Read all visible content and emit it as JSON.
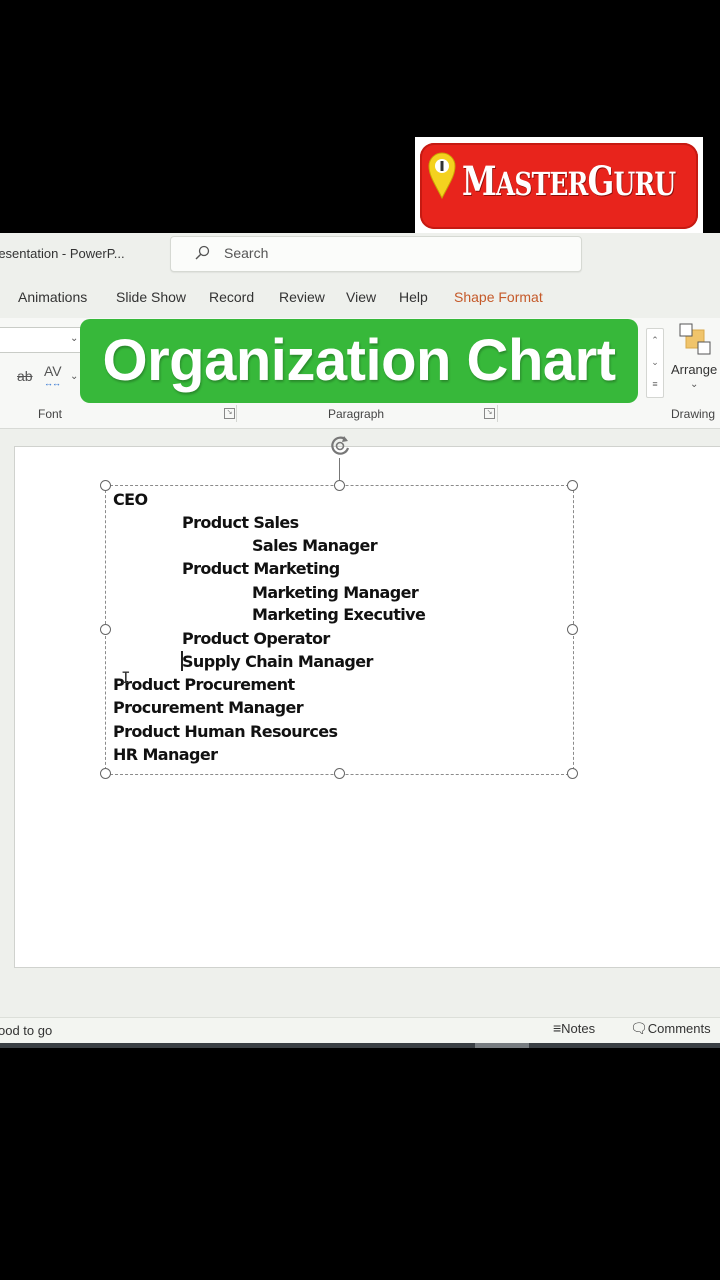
{
  "logo": {
    "brand_first": "M",
    "brand_rest_1": "ASTER",
    "brand_mid": "G",
    "brand_rest_2": "URU",
    "accent": "#e8241c"
  },
  "overlay": {
    "title": "Organization Chart",
    "color": "#37b83a"
  },
  "window": {
    "title": "resentation - PowerP..."
  },
  "search": {
    "placeholder": "Search"
  },
  "tabs": [
    {
      "label": "Animations"
    },
    {
      "label": "Slide Show"
    },
    {
      "label": "Record"
    },
    {
      "label": "Review"
    },
    {
      "label": "View"
    },
    {
      "label": "Help"
    },
    {
      "label": "Shape Format",
      "active": true
    }
  ],
  "ribbon": {
    "strike_label": "ab",
    "spacing_label": "AV",
    "groups": {
      "font": "Font",
      "paragraph": "Paragraph",
      "drawing": "Drawing"
    },
    "arrange_label": "Arrange"
  },
  "slide": {
    "lines": [
      {
        "text": "CEO",
        "level": 0
      },
      {
        "text": "Product Sales",
        "level": 1
      },
      {
        "text": "Sales Manager",
        "level": 2
      },
      {
        "text": "Product Marketing",
        "level": 1
      },
      {
        "text": "Marketing Manager",
        "level": 2
      },
      {
        "text": "Marketing Executive",
        "level": 2
      },
      {
        "text": "Product Operator",
        "level": 1
      },
      {
        "text": "Supply Chain Manager",
        "level": 1
      },
      {
        "text": "Product Procurement",
        "level": 0
      },
      {
        "text": "Procurement Manager",
        "level": 0
      },
      {
        "text": "Product Human Resources",
        "level": 0
      },
      {
        "text": "HR Manager",
        "level": 0
      }
    ]
  },
  "status": {
    "text": "ood to go",
    "notes_label": "Notes",
    "comments_label": "Comments"
  }
}
